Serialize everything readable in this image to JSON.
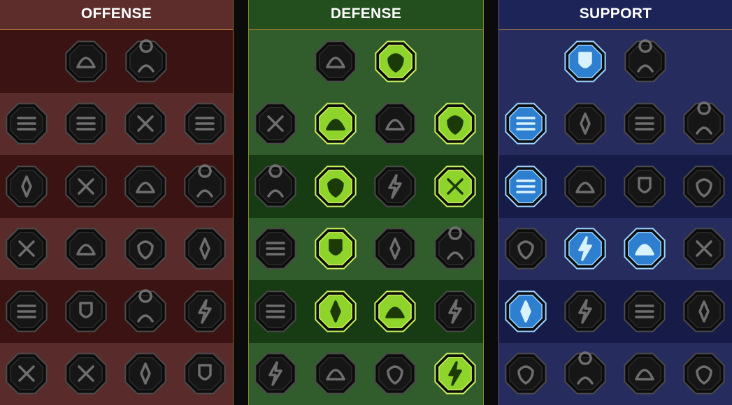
{
  "colors": {
    "inactive_fill": "#161616",
    "inactive_border": "#4a4a4a",
    "inactive_glyph": "#6e6e6e",
    "defense_active_fill": "#8fd42a",
    "defense_active_border": "#c8f060",
    "defense_active_glyph": "#1c3a08",
    "support_active_fill": "#2f7fd0",
    "support_active_border": "#9ad4ff",
    "support_active_glyph": "#d8f2ff"
  },
  "trees": [
    {
      "id": "offense",
      "title": "OFFENSE",
      "rows": [
        [
          {
            "icon": "crossed-swords-icon",
            "active": false
          },
          {
            "icon": "triple-blades-icon",
            "active": false
          }
        ],
        [
          {
            "icon": "horned-figure-icon",
            "active": false
          },
          {
            "icon": "claw-slash-icon",
            "active": false
          },
          {
            "icon": "shield-strike-icon",
            "active": false
          },
          {
            "icon": "spiked-heart-icon",
            "active": false
          }
        ],
        [
          {
            "icon": "pierced-figure-icon",
            "active": false
          },
          {
            "icon": "fanged-jaw-icon",
            "active": false
          },
          {
            "icon": "skull-sweep-icon",
            "active": false
          },
          {
            "icon": "dagger-hand-icon",
            "active": false
          }
        ],
        [
          {
            "icon": "sword-heart-icon",
            "active": false
          },
          {
            "icon": "gripped-fist-icon",
            "active": false
          },
          {
            "icon": "battle-axe-icon",
            "active": false
          },
          {
            "icon": "chained-lightning-icon",
            "active": false
          }
        ],
        [
          {
            "icon": "arrow-pit-icon",
            "active": false
          },
          {
            "icon": "twin-skulls-icon",
            "active": false
          },
          {
            "icon": "ringed-blade-icon",
            "active": false
          },
          {
            "icon": "muscle-figure-icon",
            "active": false
          }
        ],
        [
          {
            "icon": "sparkle-sword-icon",
            "active": false
          },
          {
            "icon": "knight-helm-icon",
            "active": false
          },
          {
            "icon": "demon-beast-icon",
            "active": false
          },
          {
            "icon": "radiant-skull-icon",
            "active": false
          }
        ]
      ]
    },
    {
      "id": "defense",
      "title": "DEFENSE",
      "rows": [
        [
          {
            "icon": "stacked-blocks-icon",
            "active": false
          },
          {
            "icon": "raised-fist-icon",
            "active": true
          }
        ],
        [
          {
            "icon": "layered-shield-icon",
            "active": false
          },
          {
            "icon": "anatomical-heart-icon",
            "active": true
          },
          {
            "icon": "stone-golem-icon",
            "active": false
          },
          {
            "icon": "crossed-blades-icon",
            "active": true
          }
        ],
        [
          {
            "icon": "deflect-figure-icon",
            "active": false
          },
          {
            "icon": "knight-shield-icon",
            "active": true
          },
          {
            "icon": "framed-heart-icon",
            "active": false
          },
          {
            "icon": "haloed-figure-icon",
            "active": true
          }
        ],
        [
          {
            "icon": "crowd-figures-icon",
            "active": false
          },
          {
            "icon": "hourglass-burst-icon",
            "active": true
          },
          {
            "icon": "open-palm-icon",
            "active": false
          },
          {
            "icon": "bull-head-icon",
            "active": false
          }
        ],
        [
          {
            "icon": "dash-figure-icon",
            "active": false
          },
          {
            "icon": "triple-drops-icon",
            "active": true
          },
          {
            "icon": "sun-skull-icon",
            "active": true
          },
          {
            "icon": "parry-slash-icon",
            "active": false
          }
        ],
        [
          {
            "icon": "spiked-crown-icon",
            "active": false
          },
          {
            "icon": "winged-shield-icon",
            "active": false
          },
          {
            "icon": "shining-figure-icon",
            "active": false
          },
          {
            "icon": "flexing-figure-icon",
            "active": true
          }
        ]
      ]
    },
    {
      "id": "support",
      "title": "SUPPORT",
      "rows": [
        [
          {
            "icon": "healing-heart-icon",
            "active": true
          },
          {
            "icon": "swirl-fist-icon",
            "active": false
          }
        ],
        [
          {
            "icon": "praying-hands-icon",
            "active": true
          },
          {
            "icon": "wave-shield-icon",
            "active": false
          },
          {
            "icon": "smoke-skull-icon",
            "active": false
          },
          {
            "icon": "pointing-hand-icon",
            "active": false
          }
        ],
        [
          {
            "icon": "blessed-figure-icon",
            "active": true
          },
          {
            "icon": "lightning-shield-icon",
            "active": false
          },
          {
            "icon": "cracked-ground-icon",
            "active": false
          },
          {
            "icon": "shadow-figure-icon",
            "active": false
          }
        ],
        [
          {
            "icon": "chained-heart-icon",
            "active": false
          },
          {
            "icon": "comet-icon",
            "active": true
          },
          {
            "icon": "open-book-icon",
            "active": true
          },
          {
            "icon": "angry-eyes-icon",
            "active": false
          }
        ],
        [
          {
            "icon": "compass-star-icon",
            "active": true
          },
          {
            "icon": "speed-boot-icon",
            "active": false
          },
          {
            "icon": "all-seeing-eye-icon",
            "active": false
          },
          {
            "icon": "bone-figure-icon",
            "active": false
          }
        ],
        [
          {
            "icon": "potion-flask-icon",
            "active": false
          },
          {
            "icon": "horned-skull-icon",
            "active": false
          },
          {
            "icon": "stone-fist-icon",
            "active": false
          },
          {
            "icon": "eagle-head-icon",
            "active": false
          }
        ]
      ]
    }
  ]
}
